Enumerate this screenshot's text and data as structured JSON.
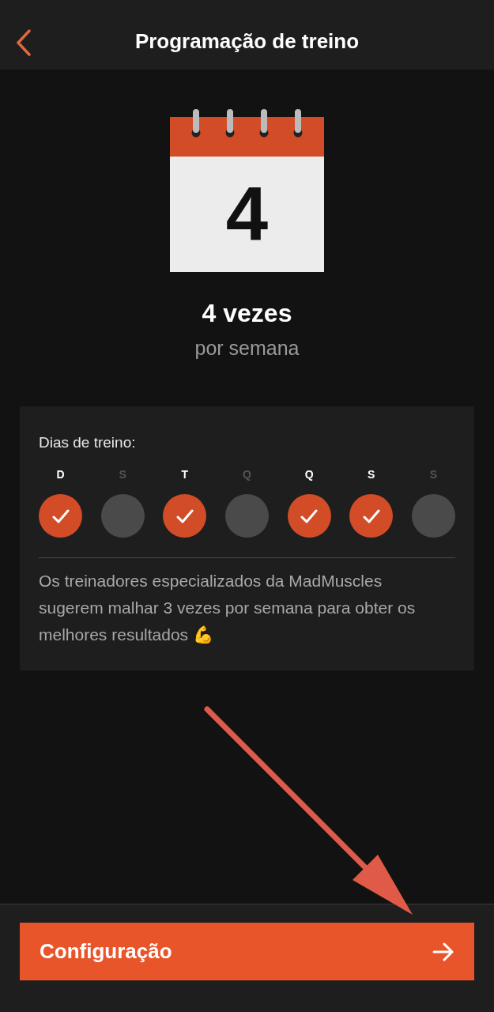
{
  "header": {
    "title": "Programação de treino"
  },
  "calendar": {
    "number": "4"
  },
  "frequency": {
    "count": "4 vezes",
    "unit": "por semana"
  },
  "schedule": {
    "label": "Dias de treino:",
    "days": [
      {
        "label": "D",
        "selected": true
      },
      {
        "label": "S",
        "selected": false
      },
      {
        "label": "T",
        "selected": true
      },
      {
        "label": "Q",
        "selected": false
      },
      {
        "label": "Q",
        "selected": true
      },
      {
        "label": "S",
        "selected": true
      },
      {
        "label": "S",
        "selected": false
      }
    ],
    "note": "Os treinadores especializados da MadMuscles sugerem malhar 3 vezes por semana para obter os melhores resultados 💪"
  },
  "footer": {
    "button": "Configuração"
  }
}
